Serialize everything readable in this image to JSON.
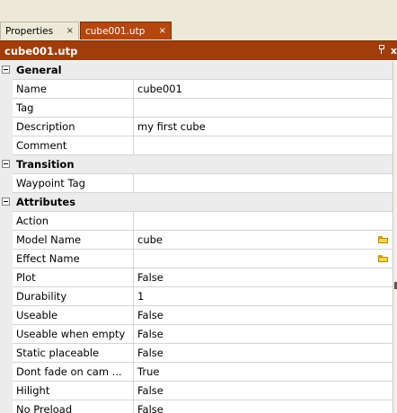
{
  "tabs": [
    {
      "label": "Properties",
      "close": "×",
      "active": false
    },
    {
      "label": "cube001.utp",
      "close": "×",
      "active": true
    }
  ],
  "panel": {
    "title": "cube001.utp",
    "close": "x"
  },
  "colors": {
    "accent": "#a03d0a",
    "active_tab": "#b4460e",
    "category_bg": "#ececec",
    "grid_line": "#d4d4d4"
  },
  "grid": {
    "rows": [
      {
        "type": "category",
        "label": "General"
      },
      {
        "type": "prop",
        "name": "Name",
        "value": "cube001"
      },
      {
        "type": "prop",
        "name": "Tag",
        "value": ""
      },
      {
        "type": "prop",
        "name": "Description",
        "value": "my first cube"
      },
      {
        "type": "prop",
        "name": "Comment",
        "value": ""
      },
      {
        "type": "category",
        "label": "Transition"
      },
      {
        "type": "prop",
        "name": "Waypoint Tag",
        "value": ""
      },
      {
        "type": "category",
        "label": "Attributes"
      },
      {
        "type": "prop",
        "name": "Action",
        "value": ""
      },
      {
        "type": "prop",
        "name": "Model Name",
        "value": "cube",
        "icon": "folder-icon"
      },
      {
        "type": "prop",
        "name": "Effect Name",
        "value": "",
        "icon": "folder-icon"
      },
      {
        "type": "prop",
        "name": "Plot",
        "value": "False"
      },
      {
        "type": "prop",
        "name": "Durability",
        "value": "1"
      },
      {
        "type": "prop",
        "name": "Useable",
        "value": "False"
      },
      {
        "type": "prop",
        "name": "Useable when empty",
        "value": "False"
      },
      {
        "type": "prop",
        "name": "Static placeable",
        "value": "False"
      },
      {
        "type": "prop",
        "name": "Dont fade on cam ...",
        "value": "True"
      },
      {
        "type": "prop",
        "name": "Hilight",
        "value": "False"
      },
      {
        "type": "prop",
        "name": "No Preload",
        "value": "False"
      }
    ]
  }
}
